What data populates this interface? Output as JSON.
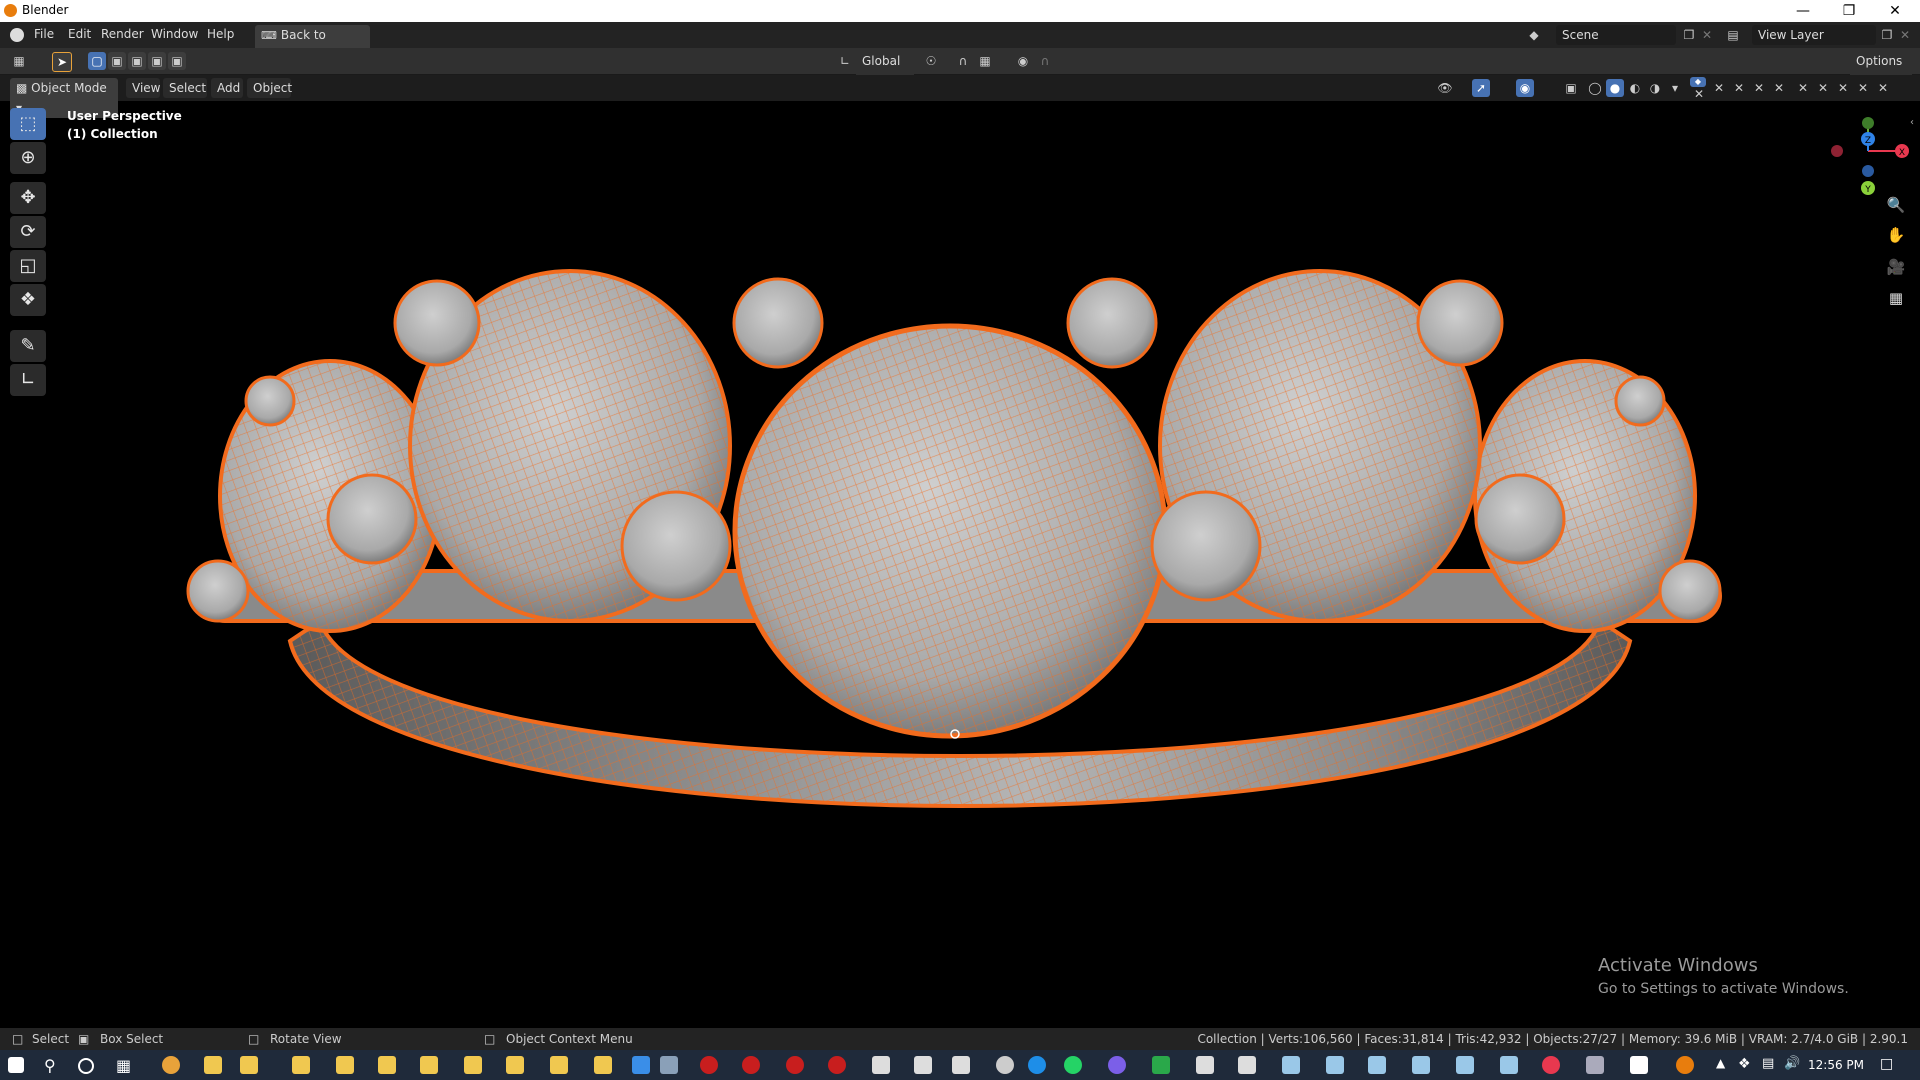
{
  "window": {
    "title": "Blender",
    "min": "—",
    "max": "❐",
    "close": "✕"
  },
  "menubar": {
    "items": [
      "File",
      "Edit",
      "Render",
      "Window",
      "Help"
    ],
    "back_label": "Back to Previous",
    "scene_label": "Scene",
    "view_layer_label": "View Layer"
  },
  "toolrow": {
    "orientation": "Global",
    "options_label": "Options"
  },
  "header": {
    "mode": "Object Mode",
    "menus": [
      "View",
      "Select",
      "Add",
      "Object"
    ]
  },
  "viewport": {
    "perspective": "User Perspective",
    "collection": "(1) Collection",
    "gizmo_labels": {
      "x": "X",
      "y": "Y",
      "z": "Z"
    }
  },
  "statusbar": {
    "select": "Select",
    "box_select": "Box Select",
    "rotate_view": "Rotate View",
    "context_menu": "Object Context Menu",
    "stats": "Collection | Verts:106,560 | Faces:31,814 | Tris:42,932 | Objects:27/27 | Memory: 39.6 MiB | VRAM: 2.7/4.0 GiB | 2.90.1"
  },
  "watermark": {
    "line1": "Activate Windows",
    "line2": "Go to Settings to activate Windows."
  },
  "taskbar": {
    "clock": "12:56 PM"
  },
  "colors": {
    "accent": "#4772b3",
    "selection_orange": "#f26b1d",
    "mesh_gray": "#b8b8b8"
  },
  "icons": [
    "blender-logo-icon",
    "select-box-icon",
    "cursor-icon",
    "move-icon",
    "rotate-icon",
    "scale-icon",
    "transform-icon",
    "annotate-icon",
    "measure-icon",
    "zoom-icon",
    "pan-hand-icon",
    "camera-icon",
    "grid-icon"
  ]
}
